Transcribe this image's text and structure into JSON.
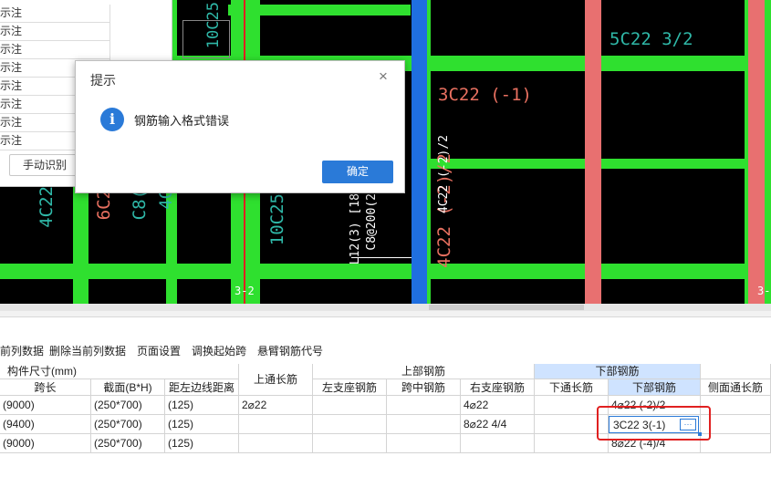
{
  "left_panel": {
    "rows": [
      "示注",
      "示注",
      "示注",
      "示注",
      "示注",
      "示注",
      "示注",
      "示注"
    ],
    "manual_button": "手动识别"
  },
  "dialog": {
    "title": "提示",
    "close": "×",
    "icon": "i",
    "message": "钢筋输入格式错误",
    "ok": "确定"
  },
  "cad": {
    "labels": {
      "c1": "10C25",
      "c2": "5C22 3/2",
      "c3": "3C22 (-1)",
      "c4": "4C22",
      "c5": "6C2",
      "c6": "C8(",
      "c7": "4C",
      "c8": "10C25",
      "c9": "L12(3) [18",
      "c10": "C8@200(2",
      "c11": "4C22 (-2)/2",
      "c12": "4C22 (-2)/2",
      "c13": "3-2",
      "c14": "3-2"
    }
  },
  "toolbar": [
    "前列数据",
    "删除当前列数据",
    "页面设置",
    "调换起始跨",
    "悬臂钢筋代号"
  ],
  "table": {
    "group_headers": {
      "size": "构件尺寸(mm)",
      "top_through": "上通长筋",
      "top_bars": "上部钢筋",
      "bottom_bars": "下部钢筋"
    },
    "columns": [
      "跨长",
      "截面(B*H)",
      "距左边线距离",
      "左支座钢筋",
      "跨中钢筋",
      "右支座钢筋",
      "下通长筋",
      "下部钢筋",
      "侧面通长筋"
    ],
    "rows": [
      {
        "span": "(9000)",
        "section": "(250*700)",
        "dist": "(125)",
        "top": "2⌀22",
        "left": "",
        "mid": "",
        "right": "4⌀22",
        "bot_thru": "",
        "bottom": "4⌀22 (-2)/2",
        "side": ""
      },
      {
        "span": "(9400)",
        "section": "(250*700)",
        "dist": "(125)",
        "top": "",
        "left": "",
        "mid": "",
        "right": "8⌀22 4/4",
        "bot_thru": "",
        "bottom": "3C22 3(-1)",
        "side": ""
      },
      {
        "span": "(9000)",
        "section": "(250*700)",
        "dist": "(125)",
        "top": "",
        "left": "",
        "mid": "",
        "right": "",
        "bot_thru": "",
        "bottom": "8⌀22 (-4)/4",
        "side": ""
      }
    ],
    "edit_button": "···"
  },
  "colors": {
    "cad_bg": "#000000",
    "beam_green": "#2fe02f",
    "column_pink": "#e87070",
    "selected_blue": "#1f6fe0",
    "accent": "#2a7ad8",
    "highlight_red": "#e02020"
  }
}
